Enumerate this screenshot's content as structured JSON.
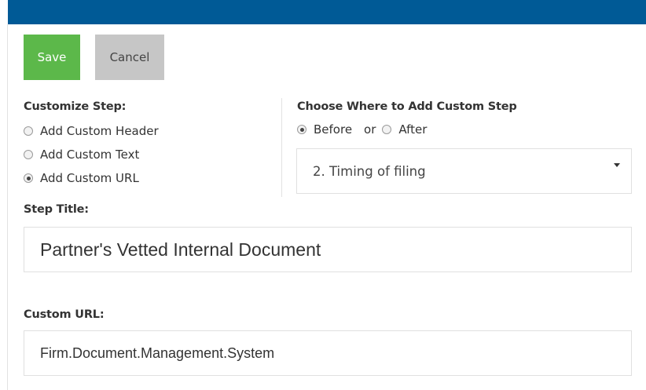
{
  "toolbar": {
    "save_label": "Save",
    "cancel_label": "Cancel"
  },
  "customize_step": {
    "label": "Customize Step:",
    "options": [
      {
        "label": "Add Custom Header",
        "checked": false
      },
      {
        "label": "Add Custom Text",
        "checked": false
      },
      {
        "label": "Add Custom URL",
        "checked": true
      }
    ]
  },
  "placement": {
    "label": "Choose Where to Add Custom Step",
    "before_label": "Before",
    "or_label": "or",
    "after_label": "After",
    "selected": "before",
    "select_value": "2. Timing of filing"
  },
  "step_title": {
    "label": "Step Title:",
    "value": "Partner's Vetted Internal Document"
  },
  "custom_url": {
    "label": "Custom URL:",
    "value": "Firm.Document.Management.System"
  },
  "colors": {
    "top_bar": "#005a96",
    "save_button": "#5cb84a",
    "cancel_button": "#c6c6c6"
  }
}
